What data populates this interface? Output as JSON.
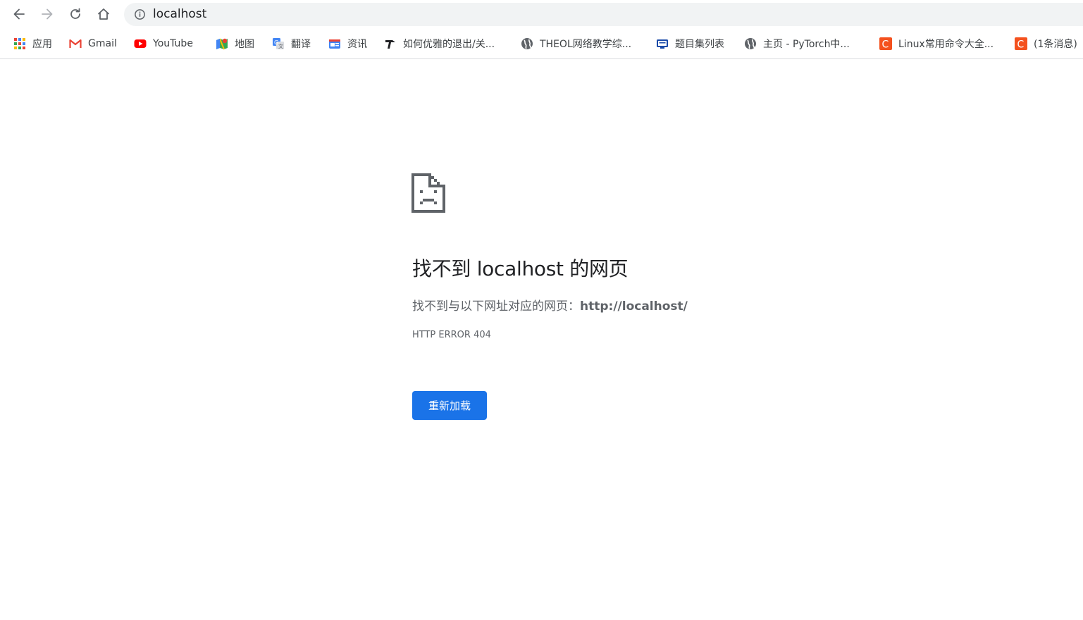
{
  "address_bar": {
    "url": "localhost"
  },
  "bookmarks": [
    {
      "label": "应用",
      "icon": "apps-grid-icon"
    },
    {
      "label": "Gmail",
      "icon": "gmail-icon"
    },
    {
      "label": "YouTube",
      "icon": "youtube-icon"
    },
    {
      "label": "地图",
      "icon": "maps-icon"
    },
    {
      "label": "翻译",
      "icon": "translate-icon"
    },
    {
      "label": "资讯",
      "icon": "news-icon"
    },
    {
      "label": "如何优雅的退出/关...",
      "icon": "tool-icon"
    },
    {
      "label": "THEOL网络教学综...",
      "icon": "globe-icon"
    },
    {
      "label": "题目集列表",
      "icon": "pta-icon"
    },
    {
      "label": "主页 - PyTorch中...",
      "icon": "globe-icon"
    },
    {
      "label": "Linux常用命令大全...",
      "icon": "csdn-icon"
    },
    {
      "label": "(1条消息)",
      "icon": "csdn-icon"
    }
  ],
  "error_page": {
    "title": "找不到 localhost 的网页",
    "description_prefix": "找不到与以下网址对应的网页：",
    "description_url": "http://localhost/",
    "error_code": "HTTP ERROR 404",
    "reload_label": "重新加载"
  },
  "colors": {
    "accent": "#1a73e8",
    "omnibox_bg": "#f1f3f4",
    "text_secondary": "#5f6368",
    "csdn_red": "#f4511e"
  }
}
